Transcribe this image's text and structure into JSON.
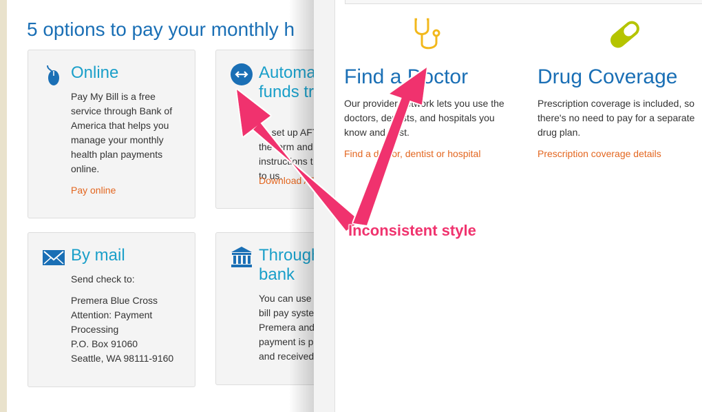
{
  "left": {
    "section_title": "5 options to pay your monthly h",
    "cards": [
      {
        "icon": "mouse-icon",
        "title": "Online",
        "body": [
          "Pay My Bill is a free",
          "service through Bank of",
          "America that helps you",
          "manage your monthly",
          "health plan payments",
          "online."
        ],
        "link": "Pay online"
      },
      {
        "icon": "arrows-circle-icon",
        "title": [
          "Automa",
          "funds tr"
        ],
        "body": [
          "To set up AFT",
          "the form and",
          "instructions t",
          "to us."
        ],
        "link": "Download AF"
      },
      {
        "icon": "envelope-icon",
        "title": "By mail",
        "body": [
          "Send check to:",
          "",
          "Premera Blue Cross",
          "Attention: Payment",
          "Processing",
          "P.O. Box 91060",
          "Seattle, WA 98111-9160"
        ]
      },
      {
        "icon": "bank-icon",
        "title": [
          "Through",
          "bank"
        ],
        "body": [
          "You can use y",
          "bill pay syste",
          "Premera and",
          "payment is p",
          "and received"
        ]
      }
    ]
  },
  "right": {
    "features": [
      {
        "icon": "stethoscope-icon",
        "title": "Find a Doctor",
        "body": [
          "Our provider network lets you use the",
          "doctors, dentists, and hospitals you",
          "know and trust."
        ],
        "link": "Find a doctor, dentist or hospital"
      },
      {
        "icon": "pill-icon",
        "title": "Drug Coverage",
        "body": [
          "Prescription coverage is included, so",
          "there's no need to pay for a separate",
          "drug plan."
        ],
        "link": "Prescription coverage details"
      }
    ]
  },
  "annotation": {
    "label": "Inconsistent style",
    "color": "#f0336e"
  },
  "colors": {
    "title_blue": "#1a6fb5",
    "card_title_blue": "#1a9fc9",
    "link_orange": "#e3661f",
    "stethoscope_yellow": "#f2b81c",
    "pill_green": "#b5c400"
  }
}
